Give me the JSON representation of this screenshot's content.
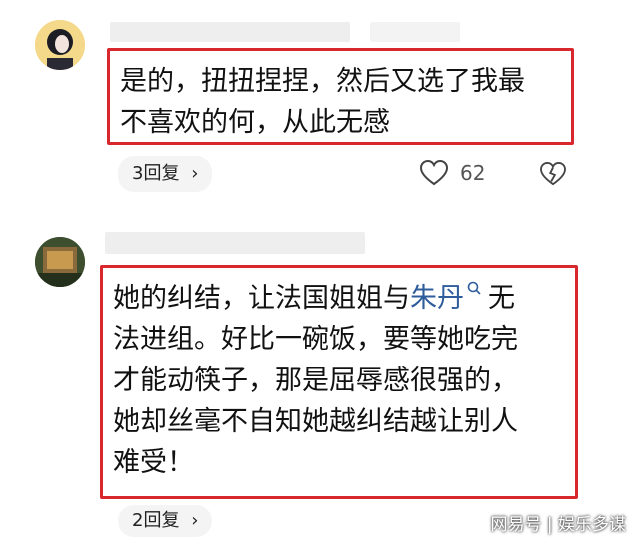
{
  "comments": [
    {
      "text_lines": [
        "是的，扭扭捏捏，然后又选了我最",
        "不喜欢的何，从此无感"
      ],
      "replies_label": "3回复",
      "like_count": "62"
    },
    {
      "line1_before": "她的纠结，让法国姐姐与",
      "line1_link": "朱丹",
      "line1_after": "无",
      "text_lines": [
        "法进组。好比一碗饭，要等她吃完",
        "才能动筷子，那是屈辱感很强的，",
        "她却丝毫不自知她越纠结越让别人",
        "难受！"
      ],
      "replies_label": "2回复"
    }
  ],
  "watermark": "网易号 | 娱乐多谋",
  "colors": {
    "highlight_border": "#d9272e",
    "link": "#2f5d9c"
  }
}
